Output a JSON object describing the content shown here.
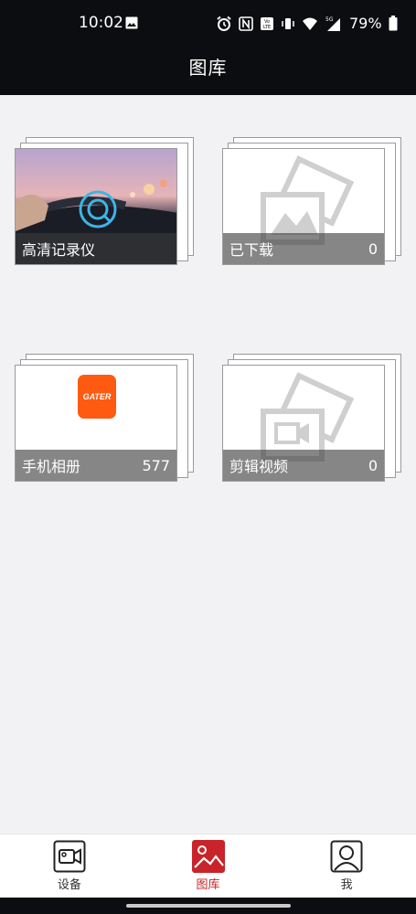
{
  "status_bar": {
    "time": "10:02",
    "battery": "79%",
    "icons": [
      "image-icon",
      "alarm-icon",
      "nfc-icon",
      "volte-icon",
      "vibrate-icon",
      "wifi-icon",
      "signal-5g-icon",
      "battery-icon"
    ]
  },
  "header": {
    "title": "图库"
  },
  "albums": [
    {
      "name": "高清记录仪",
      "count": "",
      "cover": "dashcam-photo"
    },
    {
      "name": "已下载",
      "count": "0",
      "cover": "placeholder-image"
    },
    {
      "name": "手机相册",
      "count": "577",
      "cover": "gater-logo",
      "logo_text": "GATER"
    },
    {
      "name": "剪辑视频",
      "count": "0",
      "cover": "placeholder-video"
    }
  ],
  "bottom_nav": {
    "items": [
      {
        "label": "设备",
        "icon": "camera-device-icon",
        "active": false
      },
      {
        "label": "图库",
        "icon": "gallery-icon",
        "active": true
      },
      {
        "label": "我",
        "icon": "profile-icon",
        "active": false
      }
    ]
  },
  "colors": {
    "header_bg": "#0c0d10",
    "accent": "#c8242a",
    "background": "#f2f1f3",
    "logo_orange": "#ff5a12"
  }
}
